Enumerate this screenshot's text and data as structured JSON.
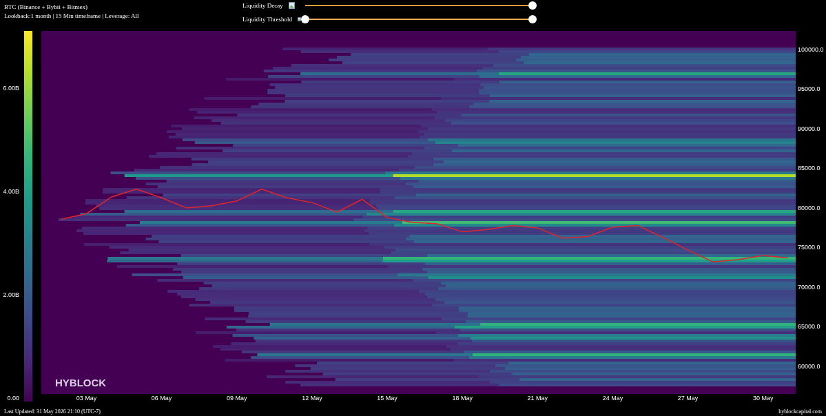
{
  "header": {
    "title": "BTC (Binance + Bybit + Bitmex)",
    "subtitle": "Lookback:1 month | 15 Min timeframe | Leverage: All"
  },
  "controls": [
    {
      "kind": "single",
      "label": "Liquidity Decay",
      "thumbs": [
        {
          "level": 1
        }
      ]
    },
    {
      "kind": "range",
      "label": "Liquidity Threshold",
      "thumbs": [
        {
          "level": 0
        },
        {
          "level": 1
        }
      ]
    }
  ],
  "chart": {
    "logo": "HYBLOCK",
    "colorbar_labels": [
      "6.00B",
      "4.00B",
      "2.00B",
      "0.00"
    ],
    "chart_data": {
      "type": "line",
      "ylim": [
        56430,
        102260
      ],
      "categories": [
        null,
        "03 May",
        null,
        null,
        "06 May",
        null,
        null,
        "09 May",
        null,
        null,
        "12 May",
        null,
        null,
        "15 May",
        null,
        null,
        "18 May",
        null,
        null,
        "21 May",
        null,
        null,
        "24 May",
        null,
        null,
        "27 May",
        null,
        null,
        "30 May",
        null
      ],
      "series": [
        {
          "color": "#e0262a",
          "values": [
            78500,
            79200,
            81300,
            82300,
            81200,
            79900,
            80200,
            80800,
            82300,
            81200,
            80600,
            79400,
            81000,
            78700,
            78100,
            77900,
            76900,
            77200,
            77700,
            77400,
            76100,
            76300,
            77500,
            77700,
            76200,
            74600,
            73100,
            73400,
            73900,
            73600
          ]
        }
      ],
      "yticks": [
        {
          "value": 100000,
          "label": "100000.0"
        },
        {
          "value": 95000,
          "label": "95000.0"
        },
        {
          "value": 90000,
          "label": "90000.0"
        },
        {
          "value": 85000,
          "label": "85000.0"
        },
        {
          "value": 80000,
          "label": "80000.0"
        },
        {
          "value": 75000,
          "label": "75000.0"
        },
        {
          "value": 70000,
          "label": "70000.0"
        },
        {
          "value": 65000,
          "label": "65000.0"
        },
        {
          "value": 60000,
          "label": "60000.0"
        }
      ]
    }
  },
  "footer": {
    "last_updated": "Last Updated: 31 May 2026 21:10 (UTC-7)",
    "site": "hyblockcapital.com"
  }
}
